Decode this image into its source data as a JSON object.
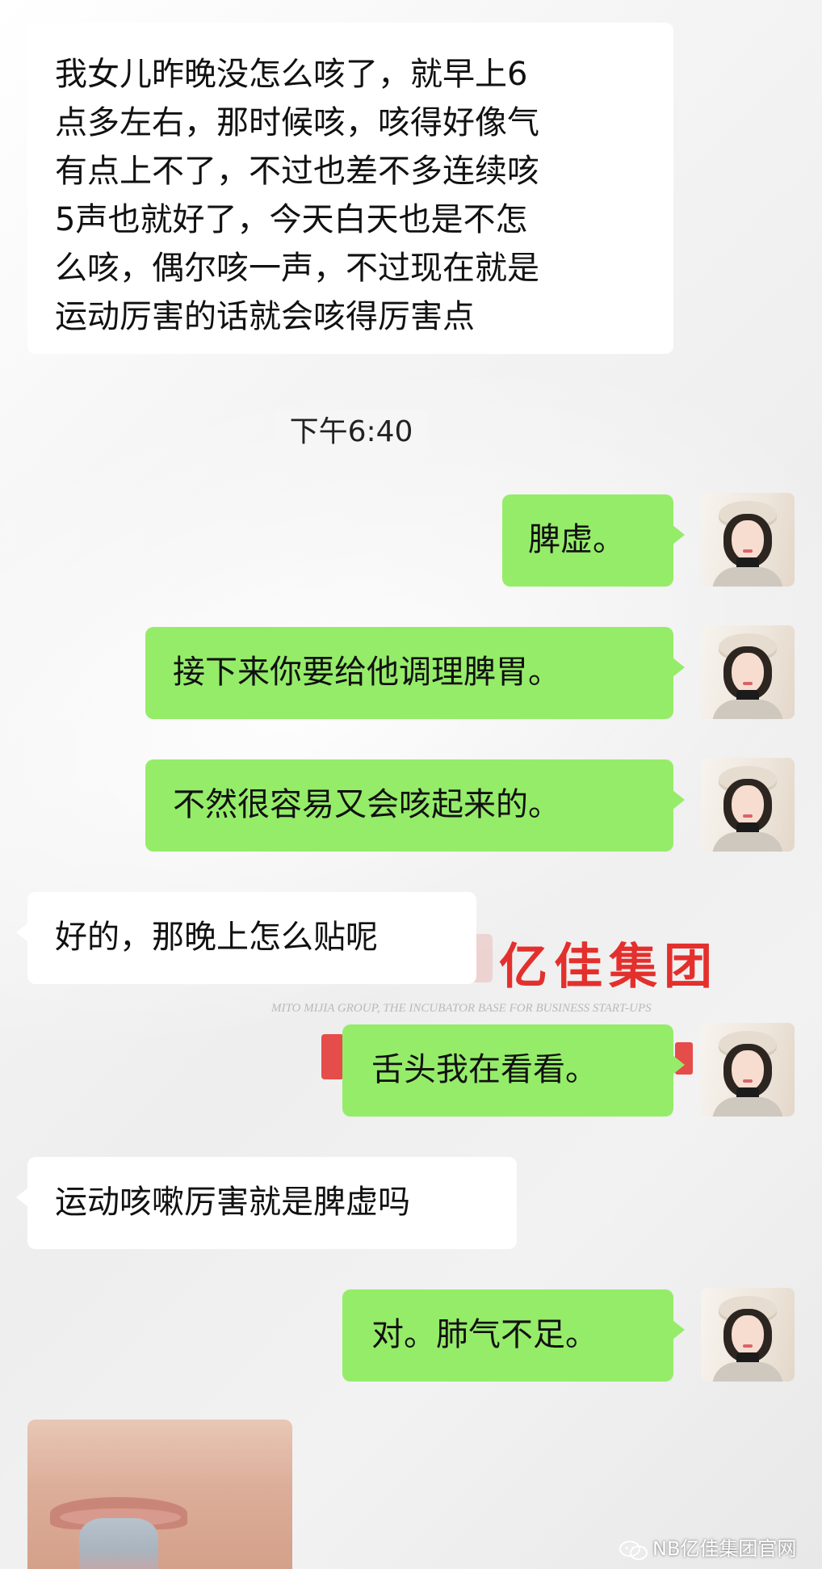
{
  "messages": {
    "m1": "我女儿昨晚没怎么咳了，就早上6\n点多左右，那时候咳，咳得好像气\n有点上不了，不过也差不多连续咳\n5声也就好了，今天白天也是不怎\n么咳，偶尔咳一声，不过现在就是\n运动厉害的话就会咳得厉害点",
    "time": "下午6:40",
    "m2": "脾虚。",
    "m3": "接下来你要给他调理脾胃。",
    "m4": "不然很容易又会咳起来的。",
    "m5": "好的，那晚上怎么贴呢",
    "m6": "舌头我在看看。",
    "m7": "运动咳嗽厉害就是脾虚吗",
    "m8": "对。肺气不足。"
  },
  "logo": {
    "title": "亿佳集团",
    "subtitle": "MITO MIJIA GROUP, THE INCUBATOR BASE FOR BUSINESS START-UPS"
  },
  "watermark": {
    "icon": "wechat-icon",
    "label": "NB亿佳集团官网"
  },
  "colors": {
    "incoming_bubble": "#ffffff",
    "outgoing_bubble": "#95ec69",
    "logo_red": "#e3302d"
  }
}
